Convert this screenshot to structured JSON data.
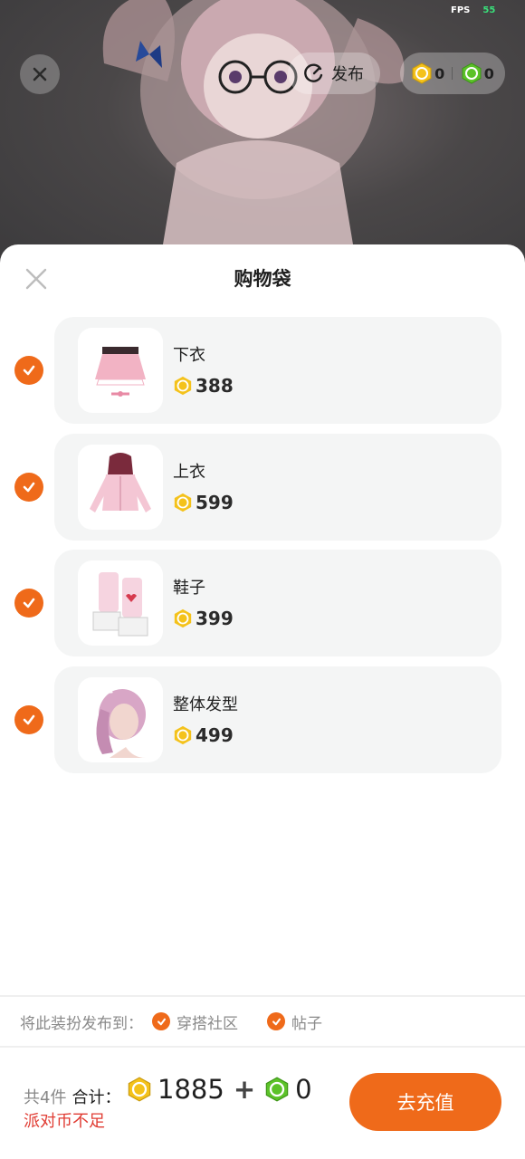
{
  "status": {
    "fps_label": "FPS",
    "fps_value": "55"
  },
  "top_bar": {
    "publish_label": "发布",
    "gold_coins": "0",
    "green_coins": "0"
  },
  "sheet": {
    "title": "购物袋",
    "items": [
      {
        "name": "下衣",
        "price": "388",
        "checked": true
      },
      {
        "name": "上衣",
        "price": "599",
        "checked": true
      },
      {
        "name": "鞋子",
        "price": "399",
        "checked": true
      },
      {
        "name": "整体发型",
        "price": "499",
        "checked": true
      }
    ],
    "publish_to_label": "将此装扮发布到：",
    "publish_options": [
      {
        "label": "穿搭社区",
        "checked": true
      },
      {
        "label": "帖子",
        "checked": true
      }
    ]
  },
  "footer": {
    "count_text": "共4件",
    "total_label": "合计：",
    "gold_total": "1885",
    "plus": "+",
    "green_total": "0",
    "warning": "派对币不足",
    "recharge_label": "去充值"
  },
  "colors": {
    "accent": "#ef6a1a",
    "warning": "#e03b32",
    "gold_coin": "#f4c21b",
    "green_coin": "#5cc229"
  }
}
